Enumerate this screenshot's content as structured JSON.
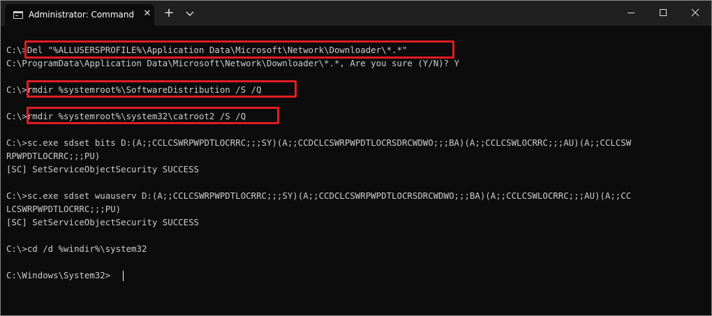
{
  "window": {
    "tab_title": "Administrator: Command Promp",
    "tab_close": "✕",
    "new_tab": "+",
    "minimize": "—",
    "maximize": "☐",
    "close": "✕"
  },
  "console": {
    "lines": [
      "C:\\>Del \"%ALLUSERSPROFILE%\\Application Data\\Microsoft\\Network\\Downloader\\*.*\"",
      "C:\\ProgramData\\Application Data\\Microsoft\\Network\\Downloader\\*.*, Are you sure (Y/N)? Y",
      "",
      "C:\\>rmdir %systemroot%\\SoftwareDistribution /S /Q",
      "",
      "C:\\>rmdir %systemroot%\\system32\\catroot2 /S /Q",
      "",
      "C:\\>sc.exe sdset bits D:(A;;CCLCSWRPWPDTLOCRRC;;;SY)(A;;CCDCLCSWRPWPDTLOCRSDRCWDWO;;;BA)(A;;CCLCSWLOCRRC;;;AU)(A;;CCLCSW",
      "RPWPDTLOCRRC;;;PU)",
      "[SC] SetServiceObjectSecurity SUCCESS",
      "",
      "C:\\>sc.exe sdset wuauserv D:(A;;CCLCSWRPWPDTLOCRRC;;;SY)(A;;CCDCLCSWRPWPDTLOCRSDRCWDWO;;;BA)(A;;CCLCSWLOCRRC;;;AU)(A;;CC",
      "LCSWRPWPDTLOCRRC;;;PU)",
      "[SC] SetServiceObjectSecurity SUCCESS",
      "",
      "C:\\>cd /d %windir%\\system32",
      "",
      "C:\\Windows\\System32>"
    ]
  },
  "colors": {
    "highlight_box": "#e41b23",
    "terminal_bg": "#0c0c0c",
    "terminal_text": "#cccccc"
  }
}
